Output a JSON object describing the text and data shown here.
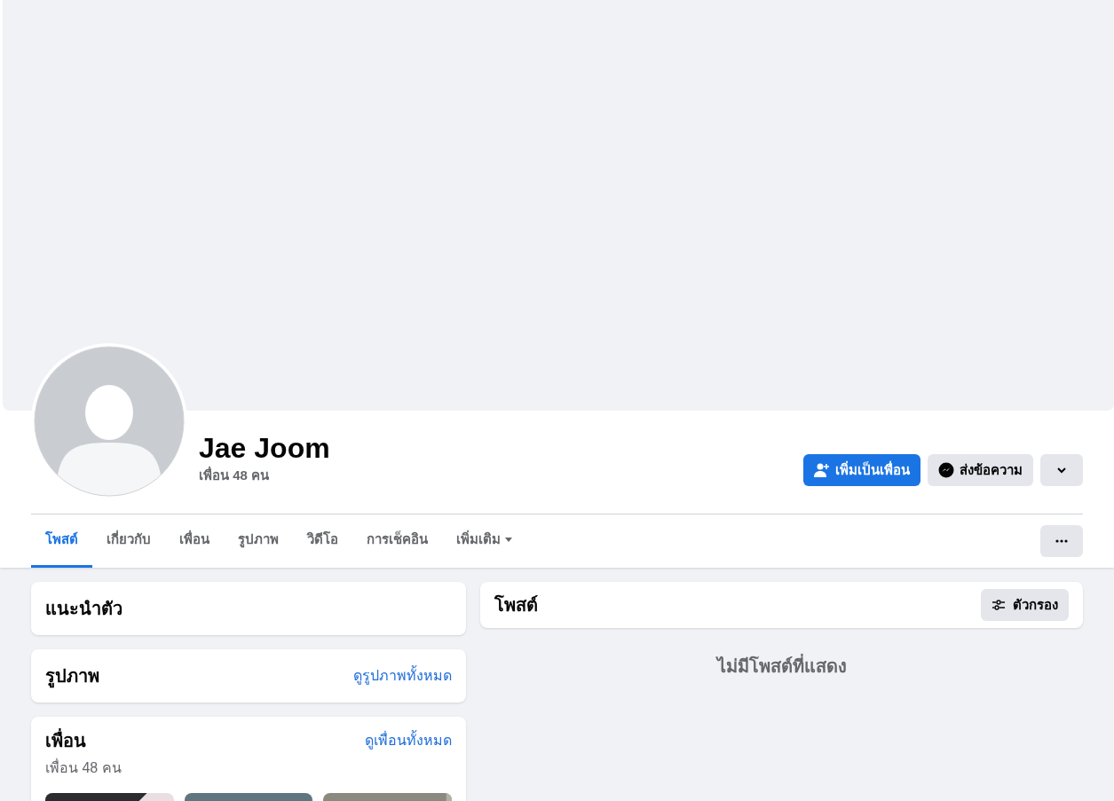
{
  "profile": {
    "name": "Jae Joom",
    "friend_count": "เพื่อน 48 คน"
  },
  "actions": [
    {
      "kind": "add_friend",
      "label": "เพิ่มเป็นเพื่อน"
    },
    {
      "kind": "message",
      "label": "ส่งข้อความ"
    },
    {
      "kind": "dropdown"
    }
  ],
  "tabs": [
    {
      "label": "โพสต์",
      "selected": true,
      "has_menu": false
    },
    {
      "label": "เกี่ยวกับ",
      "selected": false,
      "has_menu": false
    },
    {
      "label": "เพื่อน",
      "selected": false,
      "has_menu": false
    },
    {
      "label": "รูปภาพ",
      "selected": false,
      "has_menu": false
    },
    {
      "label": "วิดีโอ",
      "selected": false,
      "has_menu": false
    },
    {
      "label": "การเช็คอิน",
      "selected": false,
      "has_menu": false
    },
    {
      "label": "เพิ่มเติม",
      "selected": false,
      "has_menu": true
    }
  ],
  "intro": {
    "title": "แนะนำตัว"
  },
  "photos": {
    "title": "รูปภาพ",
    "link": "ดูรูปภาพทั้งหมด"
  },
  "friends": {
    "title": "เพื่อน",
    "link": "ดูเพื่อนทั้งหมด",
    "count": "เพื่อน 48 คน"
  },
  "posts": {
    "title": "โพสต์",
    "filter": "ตัวกรอง",
    "empty": "ไม่มีโพสต์ที่แสดง"
  }
}
